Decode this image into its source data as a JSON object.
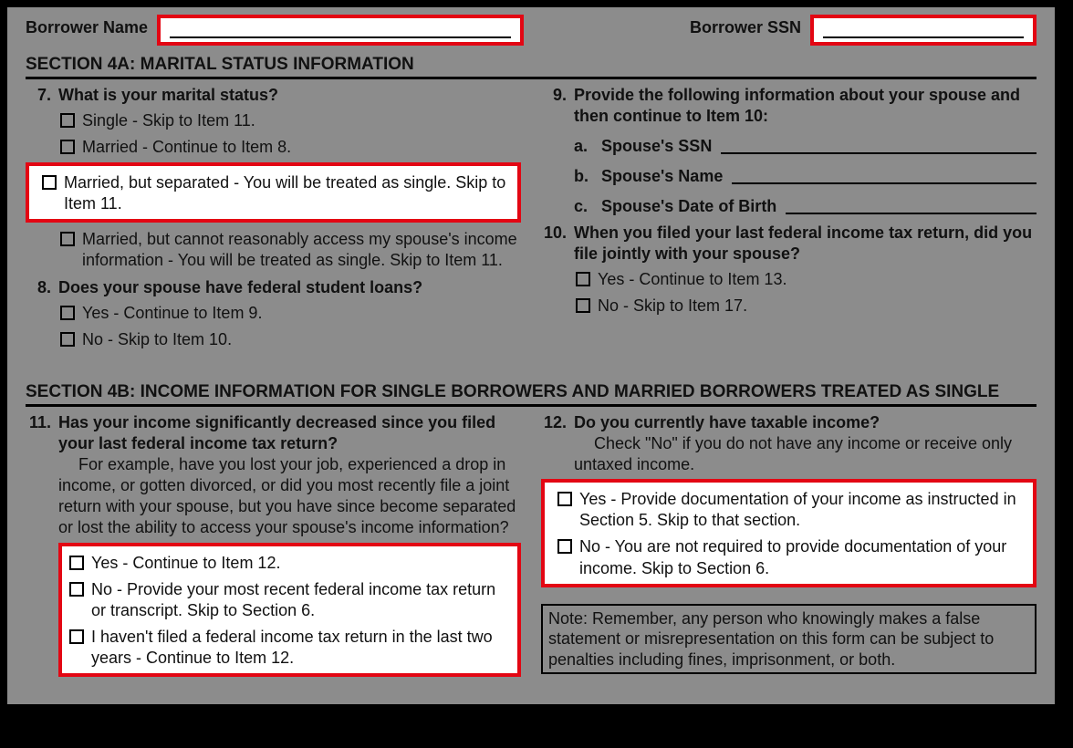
{
  "header": {
    "name_label": "Borrower Name",
    "ssn_label": "Borrower SSN"
  },
  "section4a": {
    "title": "SECTION 4A: MARITAL STATUS INFORMATION",
    "q7": {
      "num": "7.",
      "prompt": "What is your marital status?",
      "opt_single": "Single - Skip to Item 11.",
      "opt_married": "Married - Continue to Item 8.",
      "opt_separated": "Married, but separated - You will be treated as single. Skip  to Item 11.",
      "opt_noaccess": "Married, but cannot reasonably access my spouse's income information - You will be treated as single. Skip to Item 11."
    },
    "q8": {
      "num": "8.",
      "prompt": "Does your spouse have federal student loans?",
      "opt_yes": "Yes - Continue to Item 9.",
      "opt_no": "No - Skip to Item 10."
    },
    "q9": {
      "num": "9.",
      "prompt": "Provide the following information about your spouse and then continue to Item 10:",
      "a_letter": "a.",
      "a_label": "Spouse's SSN",
      "b_letter": "b.",
      "b_label": "Spouse's Name",
      "c_letter": "c.",
      "c_label": "Spouse's Date of Birth"
    },
    "q10": {
      "num": "10.",
      "prompt": "When you filed your last federal income tax return, did you file jointly with your spouse?",
      "opt_yes": "Yes - Continue to Item 13.",
      "opt_no": "No - Skip to Item 17."
    }
  },
  "section4b": {
    "title": "SECTION 4B: INCOME INFORMATION FOR SINGLE BORROWERS AND MARRIED BORROWERS TREATED AS SINGLE",
    "q11": {
      "num": "11.",
      "prompt": "Has your income significantly decreased since you filed your last federal income tax return?",
      "note": "For example, have you lost your job, experienced a drop in income, or gotten divorced, or did you most recently file a joint return with your spouse, but you have since become separated or lost the ability to access your spouse's income information?",
      "opt_yes": "Yes - Continue to Item 12.",
      "opt_no": "No - Provide your most recent federal income tax return or transcript. Skip to Section 6.",
      "opt_nofile": "I haven't filed a federal income tax return in the last two years - Continue to Item 12."
    },
    "q12": {
      "num": "12.",
      "prompt": "Do you currently have taxable income?",
      "note": "Check \"No\" if you do not have any income or receive only untaxed income.",
      "opt_yes": "Yes - Provide documentation of your income as instructed in Section 5. Skip to that section.",
      "opt_no": "No - You are not required to provide documentation of your income. Skip to Section 6."
    },
    "footer_note": "Note: Remember, any person who knowingly makes a false statement or misrepresentation on this form can be subject to penalties including fines, imprisonment, or both."
  }
}
